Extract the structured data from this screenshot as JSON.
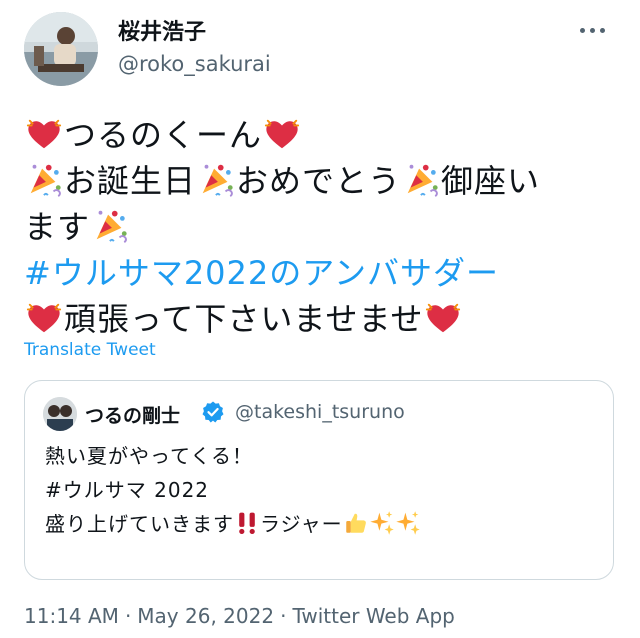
{
  "author": {
    "display_name": "桜井浩子",
    "handle": "@roko_sakurai",
    "avatar": "avatar-photo"
  },
  "tweet": {
    "lines": [
      {
        "text": "つるのくーん",
        "lead_icon": "red-heart-icon",
        "trail_icon": "red-heart-icon"
      },
      {
        "segments": [
          "お誕生日",
          "おめでとう",
          "御座い"
        ],
        "icon": "party-popper-icon"
      },
      {
        "segments": [
          "ます"
        ],
        "icon": "party-popper-icon"
      },
      {
        "hashtag": "#ウルサマ2022のアンバサダー"
      },
      {
        "text": "頑張って下さいませませ",
        "lead_icon": "red-heart-icon",
        "trail_icon": "red-heart-icon"
      }
    ]
  },
  "translate_label": "Translate Tweet",
  "quoted": {
    "display_name": "つるの剛士",
    "handle": "@takeshi_tsuruno",
    "verified_icon": "verified-badge-icon",
    "lines": [
      "熱い夏がやってくる！",
      "#ウルサマ 2022",
      "盛り上げていきます",
      "ラジャー"
    ],
    "emoji": [
      "double-exclamation-icon",
      "thumbs-up-icon",
      "sparkles-icon",
      "sparkles-icon"
    ]
  },
  "meta": {
    "time": "11:14 AM",
    "separator": "·",
    "date": "May 26, 2022",
    "source": "Twitter Web App"
  },
  "colors": {
    "link": "#1d9bf0",
    "text": "#0f1419",
    "secondary": "#536471",
    "border": "#cfd9de"
  }
}
